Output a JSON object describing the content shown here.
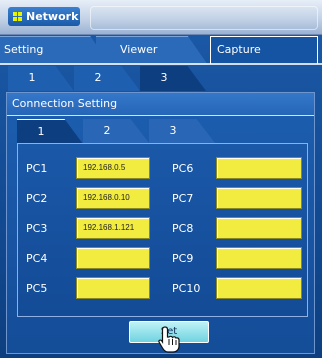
{
  "window": {
    "title": "Network",
    "colors": {
      "accent": "#1c5aa8",
      "field": "#f1ec3f",
      "button": "#8fe2ea"
    }
  },
  "top_tabs": [
    {
      "label": "Setting",
      "active": false
    },
    {
      "label": "Viewer",
      "active": false
    },
    {
      "label": "Capture",
      "active": true
    }
  ],
  "page_tabs": [
    {
      "label": "1",
      "active": false
    },
    {
      "label": "2",
      "active": false
    },
    {
      "label": "3",
      "active": true
    }
  ],
  "panel": {
    "header": "Connection Setting",
    "conn_tabs": [
      {
        "label": "1",
        "active": true
      },
      {
        "label": "2",
        "active": false
      },
      {
        "label": "3",
        "active": false
      }
    ],
    "left_column": [
      {
        "label": "PC1",
        "value": "192.168.0.5"
      },
      {
        "label": "PC2",
        "value": "192.168.0.10"
      },
      {
        "label": "PC3",
        "value": "192.168.1.121"
      },
      {
        "label": "PC4",
        "value": ""
      },
      {
        "label": "PC5",
        "value": ""
      }
    ],
    "right_column": [
      {
        "label": "PC6",
        "value": ""
      },
      {
        "label": "PC7",
        "value": ""
      },
      {
        "label": "PC8",
        "value": ""
      },
      {
        "label": "PC9",
        "value": ""
      },
      {
        "label": "PC10",
        "value": ""
      }
    ],
    "set_button": "Set"
  },
  "icons": {
    "title": "grid-icon",
    "cursor": "hand-pointer-icon"
  }
}
